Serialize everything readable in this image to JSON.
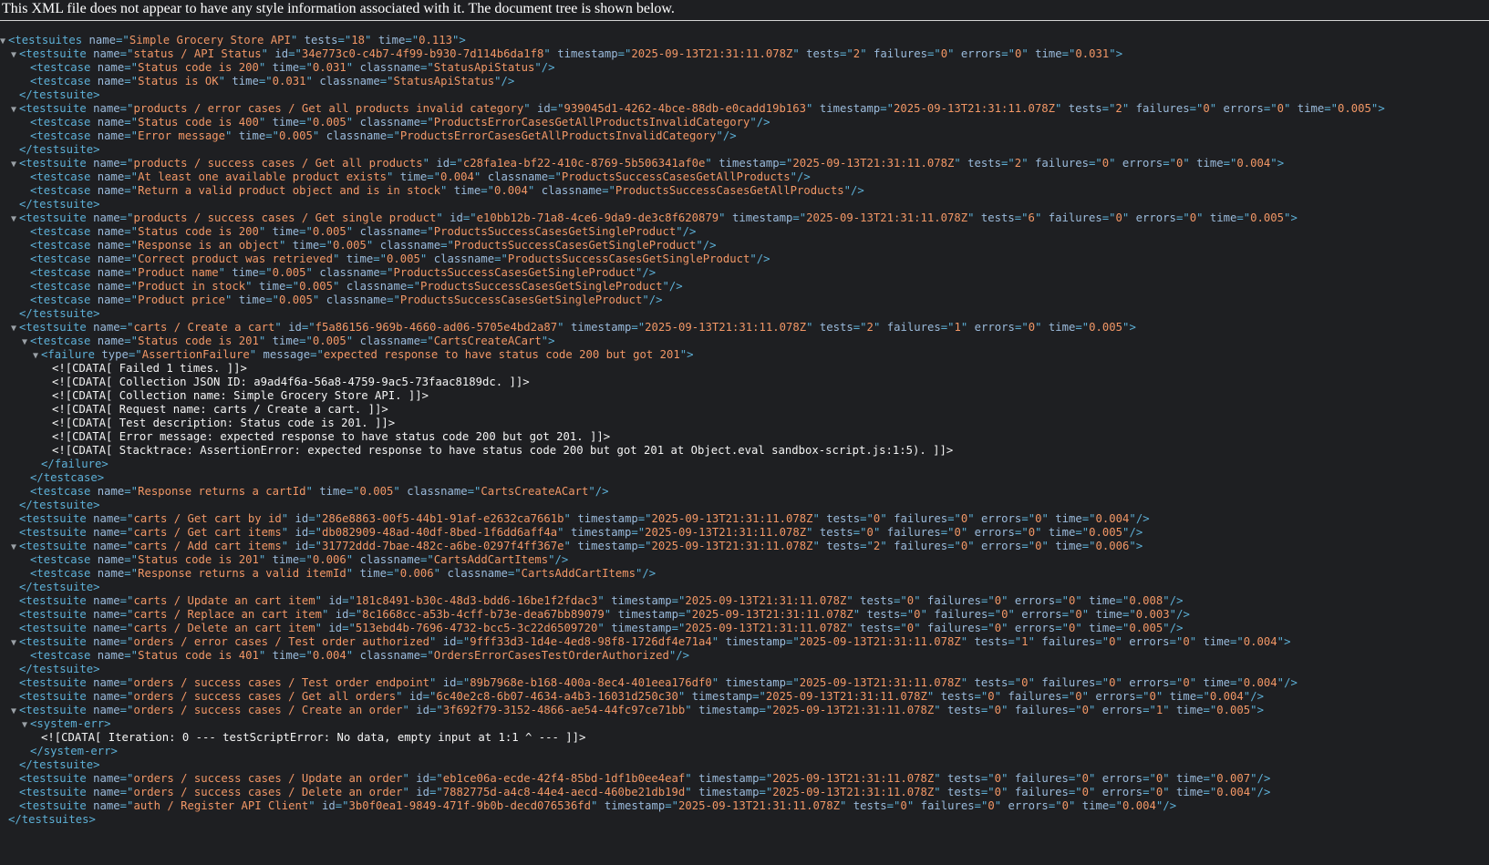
{
  "banner": "This XML file does not appear to have any style information associated with it. The document tree is shown below.",
  "root": {
    "tag": "testsuites",
    "attrs": [
      [
        "name",
        "Simple Grocery Store API"
      ],
      [
        "tests",
        "18"
      ],
      [
        "time",
        "0.113"
      ]
    ]
  },
  "suites": [
    {
      "attrs": [
        [
          "name",
          "status / API Status"
        ],
        [
          "id",
          "34e773c0-c4b7-4f99-b930-7d114b6da1f8"
        ],
        [
          "timestamp",
          "2025-09-13T21:31:11.078Z"
        ],
        [
          "tests",
          "2"
        ],
        [
          "failures",
          "0"
        ],
        [
          "errors",
          "0"
        ],
        [
          "time",
          "0.031"
        ]
      ],
      "children": [
        {
          "type": "testcase",
          "attrs": [
            [
              "name",
              "Status code is 200"
            ],
            [
              "time",
              "0.031"
            ],
            [
              "classname",
              "StatusApiStatus"
            ]
          ]
        },
        {
          "type": "testcase",
          "attrs": [
            [
              "name",
              "Status is OK"
            ],
            [
              "time",
              "0.031"
            ],
            [
              "classname",
              "StatusApiStatus"
            ]
          ]
        }
      ]
    },
    {
      "attrs": [
        [
          "name",
          "products / error cases / Get all products invalid category"
        ],
        [
          "id",
          "939045d1-4262-4bce-88db-e0cadd19b163"
        ],
        [
          "timestamp",
          "2025-09-13T21:31:11.078Z"
        ],
        [
          "tests",
          "2"
        ],
        [
          "failures",
          "0"
        ],
        [
          "errors",
          "0"
        ],
        [
          "time",
          "0.005"
        ]
      ],
      "children": [
        {
          "type": "testcase",
          "attrs": [
            [
              "name",
              "Status code is 400"
            ],
            [
              "time",
              "0.005"
            ],
            [
              "classname",
              "ProductsErrorCasesGetAllProductsInvalidCategory"
            ]
          ]
        },
        {
          "type": "testcase",
          "attrs": [
            [
              "name",
              "Error message"
            ],
            [
              "time",
              "0.005"
            ],
            [
              "classname",
              "ProductsErrorCasesGetAllProductsInvalidCategory"
            ]
          ]
        }
      ]
    },
    {
      "attrs": [
        [
          "name",
          "products / success cases / Get all products"
        ],
        [
          "id",
          "c28fa1ea-bf22-410c-8769-5b506341af0e"
        ],
        [
          "timestamp",
          "2025-09-13T21:31:11.078Z"
        ],
        [
          "tests",
          "2"
        ],
        [
          "failures",
          "0"
        ],
        [
          "errors",
          "0"
        ],
        [
          "time",
          "0.004"
        ]
      ],
      "children": [
        {
          "type": "testcase",
          "attrs": [
            [
              "name",
              "At least one available product exists"
            ],
            [
              "time",
              "0.004"
            ],
            [
              "classname",
              "ProductsSuccessCasesGetAllProducts"
            ]
          ]
        },
        {
          "type": "testcase",
          "attrs": [
            [
              "name",
              "Return a valid product object and is in stock"
            ],
            [
              "time",
              "0.004"
            ],
            [
              "classname",
              "ProductsSuccessCasesGetAllProducts"
            ]
          ]
        }
      ]
    },
    {
      "attrs": [
        [
          "name",
          "products / success cases / Get single product"
        ],
        [
          "id",
          "e10bb12b-71a8-4ce6-9da9-de3c8f620879"
        ],
        [
          "timestamp",
          "2025-09-13T21:31:11.078Z"
        ],
        [
          "tests",
          "6"
        ],
        [
          "failures",
          "0"
        ],
        [
          "errors",
          "0"
        ],
        [
          "time",
          "0.005"
        ]
      ],
      "children": [
        {
          "type": "testcase",
          "attrs": [
            [
              "name",
              "Status code is 200"
            ],
            [
              "time",
              "0.005"
            ],
            [
              "classname",
              "ProductsSuccessCasesGetSingleProduct"
            ]
          ]
        },
        {
          "type": "testcase",
          "attrs": [
            [
              "name",
              "Response is an object"
            ],
            [
              "time",
              "0.005"
            ],
            [
              "classname",
              "ProductsSuccessCasesGetSingleProduct"
            ]
          ]
        },
        {
          "type": "testcase",
          "attrs": [
            [
              "name",
              "Correct product was retrieved"
            ],
            [
              "time",
              "0.005"
            ],
            [
              "classname",
              "ProductsSuccessCasesGetSingleProduct"
            ]
          ]
        },
        {
          "type": "testcase",
          "attrs": [
            [
              "name",
              "Product name"
            ],
            [
              "time",
              "0.005"
            ],
            [
              "classname",
              "ProductsSuccessCasesGetSingleProduct"
            ]
          ]
        },
        {
          "type": "testcase",
          "attrs": [
            [
              "name",
              "Product in stock"
            ],
            [
              "time",
              "0.005"
            ],
            [
              "classname",
              "ProductsSuccessCasesGetSingleProduct"
            ]
          ]
        },
        {
          "type": "testcase",
          "attrs": [
            [
              "name",
              "Product price"
            ],
            [
              "time",
              "0.005"
            ],
            [
              "classname",
              "ProductsSuccessCasesGetSingleProduct"
            ]
          ]
        }
      ]
    },
    {
      "attrs": [
        [
          "name",
          "carts / Create a cart"
        ],
        [
          "id",
          "f5a86156-969b-4660-ad06-5705e4bd2a87"
        ],
        [
          "timestamp",
          "2025-09-13T21:31:11.078Z"
        ],
        [
          "tests",
          "2"
        ],
        [
          "failures",
          "1"
        ],
        [
          "errors",
          "0"
        ],
        [
          "time",
          "0.005"
        ]
      ],
      "children": [
        {
          "type": "testcase",
          "attrs": [
            [
              "name",
              "Status code is 201"
            ],
            [
              "time",
              "0.005"
            ],
            [
              "classname",
              "CartsCreateACart"
            ]
          ],
          "failure": {
            "attrs": [
              [
                "type",
                "AssertionFailure"
              ],
              [
                "message",
                "expected response to have status code 200 but got 201"
              ]
            ],
            "cdata": [
              "<![CDATA[ Failed 1 times. ]]>",
              "<![CDATA[ Collection JSON ID: a9ad4f6a-56a8-4759-9ac5-73faac8189dc. ]]>",
              "<![CDATA[ Collection name: Simple Grocery Store API. ]]>",
              "<![CDATA[ Request name: carts / Create a cart. ]]>",
              "<![CDATA[ Test description: Status code is 201. ]]>",
              "<![CDATA[ Error message: expected response to have status code 200 but got 201. ]]>",
              "<![CDATA[ Stacktrace: AssertionError: expected response to have status code 200 but got 201 at Object.eval sandbox-script.js:1:5). ]]>"
            ]
          }
        },
        {
          "type": "testcase",
          "attrs": [
            [
              "name",
              "Response returns a cartId"
            ],
            [
              "time",
              "0.005"
            ],
            [
              "classname",
              "CartsCreateACart"
            ]
          ]
        }
      ]
    },
    {
      "attrs": [
        [
          "name",
          "carts / Get cart by id"
        ],
        [
          "id",
          "286e8863-00f5-44b1-91af-e2632ca7661b"
        ],
        [
          "timestamp",
          "2025-09-13T21:31:11.078Z"
        ],
        [
          "tests",
          "0"
        ],
        [
          "failures",
          "0"
        ],
        [
          "errors",
          "0"
        ],
        [
          "time",
          "0.004"
        ]
      ],
      "children": []
    },
    {
      "attrs": [
        [
          "name",
          "carts / Get cart items"
        ],
        [
          "id",
          "db082909-48ad-40df-8bed-1f6dd6aff4a"
        ],
        [
          "timestamp",
          "2025-09-13T21:31:11.078Z"
        ],
        [
          "tests",
          "0"
        ],
        [
          "failures",
          "0"
        ],
        [
          "errors",
          "0"
        ],
        [
          "time",
          "0.005"
        ]
      ],
      "children": []
    },
    {
      "attrs": [
        [
          "name",
          "carts / Add cart items"
        ],
        [
          "id",
          "31772ddd-7bae-482c-a6be-0297f4ff367e"
        ],
        [
          "timestamp",
          "2025-09-13T21:31:11.078Z"
        ],
        [
          "tests",
          "2"
        ],
        [
          "failures",
          "0"
        ],
        [
          "errors",
          "0"
        ],
        [
          "time",
          "0.006"
        ]
      ],
      "children": [
        {
          "type": "testcase",
          "attrs": [
            [
              "name",
              "Status code is 201"
            ],
            [
              "time",
              "0.006"
            ],
            [
              "classname",
              "CartsAddCartItems"
            ]
          ]
        },
        {
          "type": "testcase",
          "attrs": [
            [
              "name",
              "Response returns a valid itemId"
            ],
            [
              "time",
              "0.006"
            ],
            [
              "classname",
              "CartsAddCartItems"
            ]
          ]
        }
      ]
    },
    {
      "attrs": [
        [
          "name",
          "carts / Update an cart item"
        ],
        [
          "id",
          "181c8491-b30c-48d3-bdd6-16be1f2fdac3"
        ],
        [
          "timestamp",
          "2025-09-13T21:31:11.078Z"
        ],
        [
          "tests",
          "0"
        ],
        [
          "failures",
          "0"
        ],
        [
          "errors",
          "0"
        ],
        [
          "time",
          "0.008"
        ]
      ],
      "children": []
    },
    {
      "attrs": [
        [
          "name",
          "carts / Replace an cart item"
        ],
        [
          "id",
          "8c1668cc-a53b-4cff-b73e-dea67bb89079"
        ],
        [
          "timestamp",
          "2025-09-13T21:31:11.078Z"
        ],
        [
          "tests",
          "0"
        ],
        [
          "failures",
          "0"
        ],
        [
          "errors",
          "0"
        ],
        [
          "time",
          "0.003"
        ]
      ],
      "children": []
    },
    {
      "attrs": [
        [
          "name",
          "carts / Delete an cart item"
        ],
        [
          "id",
          "513ebd4b-7696-4732-bcc5-3c22d6509720"
        ],
        [
          "timestamp",
          "2025-09-13T21:31:11.078Z"
        ],
        [
          "tests",
          "0"
        ],
        [
          "failures",
          "0"
        ],
        [
          "errors",
          "0"
        ],
        [
          "time",
          "0.005"
        ]
      ],
      "children": []
    },
    {
      "attrs": [
        [
          "name",
          "orders / error cases / Test order authorized"
        ],
        [
          "id",
          "9fff33d3-1d4e-4ed8-98f8-1726df4e71a4"
        ],
        [
          "timestamp",
          "2025-09-13T21:31:11.078Z"
        ],
        [
          "tests",
          "1"
        ],
        [
          "failures",
          "0"
        ],
        [
          "errors",
          "0"
        ],
        [
          "time",
          "0.004"
        ]
      ],
      "children": [
        {
          "type": "testcase",
          "attrs": [
            [
              "name",
              "Status code is 401"
            ],
            [
              "time",
              "0.004"
            ],
            [
              "classname",
              "OrdersErrorCasesTestOrderAuthorized"
            ]
          ]
        }
      ]
    },
    {
      "attrs": [
        [
          "name",
          "orders / success cases / Test order endpoint"
        ],
        [
          "id",
          "89b7968e-b168-400a-8ec4-401eea176df0"
        ],
        [
          "timestamp",
          "2025-09-13T21:31:11.078Z"
        ],
        [
          "tests",
          "0"
        ],
        [
          "failures",
          "0"
        ],
        [
          "errors",
          "0"
        ],
        [
          "time",
          "0.004"
        ]
      ],
      "children": []
    },
    {
      "attrs": [
        [
          "name",
          "orders / success cases / Get all orders"
        ],
        [
          "id",
          "6c40e2c8-6b07-4634-a4b3-16031d250c30"
        ],
        [
          "timestamp",
          "2025-09-13T21:31:11.078Z"
        ],
        [
          "tests",
          "0"
        ],
        [
          "failures",
          "0"
        ],
        [
          "errors",
          "0"
        ],
        [
          "time",
          "0.004"
        ]
      ],
      "children": []
    },
    {
      "attrs": [
        [
          "name",
          "orders / success cases / Create an order"
        ],
        [
          "id",
          "3f692f79-3152-4866-ae54-44fc97ce71bb"
        ],
        [
          "timestamp",
          "2025-09-13T21:31:11.078Z"
        ],
        [
          "tests",
          "0"
        ],
        [
          "failures",
          "0"
        ],
        [
          "errors",
          "1"
        ],
        [
          "time",
          "0.005"
        ]
      ],
      "children": [
        {
          "type": "system-err",
          "cdata": [
            "<![CDATA[ Iteration: 0 --- testScriptError: No data, empty input at 1:1 ^ --- ]]>"
          ]
        }
      ]
    },
    {
      "attrs": [
        [
          "name",
          "orders / success cases / Update an order"
        ],
        [
          "id",
          "eb1ce06a-ecde-42f4-85bd-1df1b0ee4eaf"
        ],
        [
          "timestamp",
          "2025-09-13T21:31:11.078Z"
        ],
        [
          "tests",
          "0"
        ],
        [
          "failures",
          "0"
        ],
        [
          "errors",
          "0"
        ],
        [
          "time",
          "0.007"
        ]
      ],
      "children": []
    },
    {
      "attrs": [
        [
          "name",
          "orders / success cases / Delete an order"
        ],
        [
          "id",
          "7882775d-a4c8-44e4-aecd-460be21db19d"
        ],
        [
          "timestamp",
          "2025-09-13T21:31:11.078Z"
        ],
        [
          "tests",
          "0"
        ],
        [
          "failures",
          "0"
        ],
        [
          "errors",
          "0"
        ],
        [
          "time",
          "0.004"
        ]
      ],
      "children": []
    },
    {
      "attrs": [
        [
          "name",
          "auth / Register API Client"
        ],
        [
          "id",
          "3b0f0ea1-9849-471f-9b0b-decd076536fd"
        ],
        [
          "timestamp",
          "2025-09-13T21:31:11.078Z"
        ],
        [
          "tests",
          "0"
        ],
        [
          "failures",
          "0"
        ],
        [
          "errors",
          "0"
        ],
        [
          "time",
          "0.004"
        ]
      ],
      "children": []
    }
  ],
  "colors": {
    "tag": "#5db0d7",
    "attr_name": "#9bbbdc",
    "attr_value": "#f29766",
    "text": "#f4f4f4",
    "background": "#1e1f22"
  },
  "icons": {
    "expanded": "triangle-down-icon"
  }
}
